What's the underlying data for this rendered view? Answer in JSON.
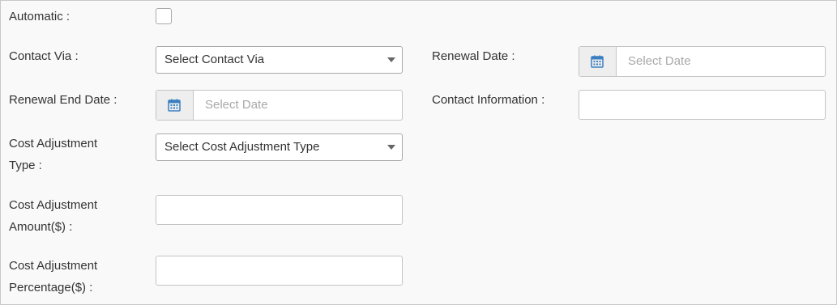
{
  "form": {
    "automatic": {
      "label": "Automatic :",
      "checked": false
    },
    "contact_via": {
      "label": "Contact Via :",
      "value": "Select Contact Via"
    },
    "renewal_date": {
      "label": "Renewal Date :",
      "placeholder": "Select Date"
    },
    "renewal_end_date": {
      "label": "Renewal End Date :",
      "placeholder": "Select Date"
    },
    "contact_information": {
      "label": "Contact Information :",
      "value": ""
    },
    "cost_adjustment_type": {
      "label_line1": "Cost Adjustment",
      "label_line2": "Type :",
      "value": "Select Cost Adjustment Type"
    },
    "cost_adjustment_amount": {
      "label_line1": "Cost Adjustment",
      "label_line2": "Amount($) :",
      "value": ""
    },
    "cost_adjustment_percentage": {
      "label_line1": "Cost Adjustment",
      "label_line2": "Percentage($) :",
      "value": ""
    }
  },
  "icons": {
    "calendar": "calendar-icon",
    "dropdown": "chevron-down-icon"
  },
  "colors": {
    "calendar_icon": "#3a7fc1",
    "placeholder": "#a8a8a8",
    "addon_bg": "#eeeeee"
  }
}
